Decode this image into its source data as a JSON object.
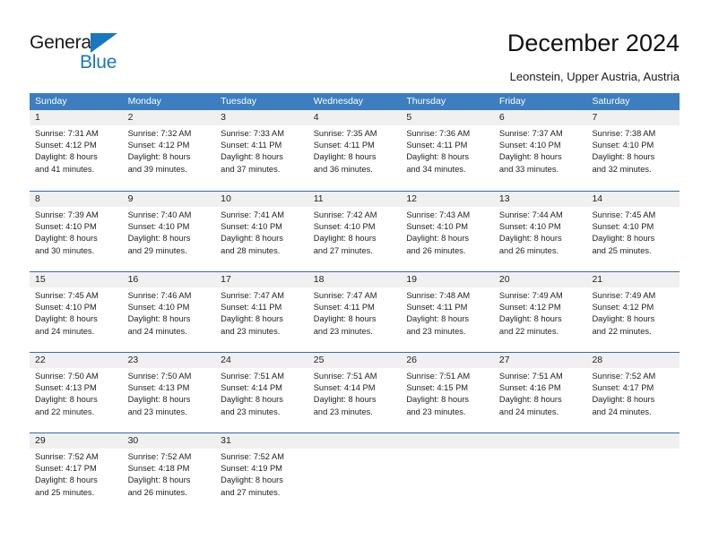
{
  "brand": {
    "name_part1": "General",
    "name_part2": "Blue",
    "triangle_icon": "triangle-icon",
    "accent_color": "#1877BF"
  },
  "header": {
    "title": "December 2024",
    "subtitle": "Leonstein, Upper Austria, Austria"
  },
  "calendar": {
    "header_color": "#3C7EBF",
    "row_separator_color": "#2E6DAE",
    "date_strip_color": "#F0F0F0",
    "day_headers": [
      "Sunday",
      "Monday",
      "Tuesday",
      "Wednesday",
      "Thursday",
      "Friday",
      "Saturday"
    ],
    "weeks": [
      [
        {
          "date": "1",
          "sunrise": "Sunrise: 7:31 AM",
          "sunset": "Sunset: 4:12 PM",
          "daylight_1": "Daylight: 8 hours",
          "daylight_2": "and 41 minutes."
        },
        {
          "date": "2",
          "sunrise": "Sunrise: 7:32 AM",
          "sunset": "Sunset: 4:12 PM",
          "daylight_1": "Daylight: 8 hours",
          "daylight_2": "and 39 minutes."
        },
        {
          "date": "3",
          "sunrise": "Sunrise: 7:33 AM",
          "sunset": "Sunset: 4:11 PM",
          "daylight_1": "Daylight: 8 hours",
          "daylight_2": "and 37 minutes."
        },
        {
          "date": "4",
          "sunrise": "Sunrise: 7:35 AM",
          "sunset": "Sunset: 4:11 PM",
          "daylight_1": "Daylight: 8 hours",
          "daylight_2": "and 36 minutes."
        },
        {
          "date": "5",
          "sunrise": "Sunrise: 7:36 AM",
          "sunset": "Sunset: 4:11 PM",
          "daylight_1": "Daylight: 8 hours",
          "daylight_2": "and 34 minutes."
        },
        {
          "date": "6",
          "sunrise": "Sunrise: 7:37 AM",
          "sunset": "Sunset: 4:10 PM",
          "daylight_1": "Daylight: 8 hours",
          "daylight_2": "and 33 minutes."
        },
        {
          "date": "7",
          "sunrise": "Sunrise: 7:38 AM",
          "sunset": "Sunset: 4:10 PM",
          "daylight_1": "Daylight: 8 hours",
          "daylight_2": "and 32 minutes."
        }
      ],
      [
        {
          "date": "8",
          "sunrise": "Sunrise: 7:39 AM",
          "sunset": "Sunset: 4:10 PM",
          "daylight_1": "Daylight: 8 hours",
          "daylight_2": "and 30 minutes."
        },
        {
          "date": "9",
          "sunrise": "Sunrise: 7:40 AM",
          "sunset": "Sunset: 4:10 PM",
          "daylight_1": "Daylight: 8 hours",
          "daylight_2": "and 29 minutes."
        },
        {
          "date": "10",
          "sunrise": "Sunrise: 7:41 AM",
          "sunset": "Sunset: 4:10 PM",
          "daylight_1": "Daylight: 8 hours",
          "daylight_2": "and 28 minutes."
        },
        {
          "date": "11",
          "sunrise": "Sunrise: 7:42 AM",
          "sunset": "Sunset: 4:10 PM",
          "daylight_1": "Daylight: 8 hours",
          "daylight_2": "and 27 minutes."
        },
        {
          "date": "12",
          "sunrise": "Sunrise: 7:43 AM",
          "sunset": "Sunset: 4:10 PM",
          "daylight_1": "Daylight: 8 hours",
          "daylight_2": "and 26 minutes."
        },
        {
          "date": "13",
          "sunrise": "Sunrise: 7:44 AM",
          "sunset": "Sunset: 4:10 PM",
          "daylight_1": "Daylight: 8 hours",
          "daylight_2": "and 26 minutes."
        },
        {
          "date": "14",
          "sunrise": "Sunrise: 7:45 AM",
          "sunset": "Sunset: 4:10 PM",
          "daylight_1": "Daylight: 8 hours",
          "daylight_2": "and 25 minutes."
        }
      ],
      [
        {
          "date": "15",
          "sunrise": "Sunrise: 7:45 AM",
          "sunset": "Sunset: 4:10 PM",
          "daylight_1": "Daylight: 8 hours",
          "daylight_2": "and 24 minutes."
        },
        {
          "date": "16",
          "sunrise": "Sunrise: 7:46 AM",
          "sunset": "Sunset: 4:10 PM",
          "daylight_1": "Daylight: 8 hours",
          "daylight_2": "and 24 minutes."
        },
        {
          "date": "17",
          "sunrise": "Sunrise: 7:47 AM",
          "sunset": "Sunset: 4:11 PM",
          "daylight_1": "Daylight: 8 hours",
          "daylight_2": "and 23 minutes."
        },
        {
          "date": "18",
          "sunrise": "Sunrise: 7:47 AM",
          "sunset": "Sunset: 4:11 PM",
          "daylight_1": "Daylight: 8 hours",
          "daylight_2": "and 23 minutes."
        },
        {
          "date": "19",
          "sunrise": "Sunrise: 7:48 AM",
          "sunset": "Sunset: 4:11 PM",
          "daylight_1": "Daylight: 8 hours",
          "daylight_2": "and 23 minutes."
        },
        {
          "date": "20",
          "sunrise": "Sunrise: 7:49 AM",
          "sunset": "Sunset: 4:12 PM",
          "daylight_1": "Daylight: 8 hours",
          "daylight_2": "and 22 minutes."
        },
        {
          "date": "21",
          "sunrise": "Sunrise: 7:49 AM",
          "sunset": "Sunset: 4:12 PM",
          "daylight_1": "Daylight: 8 hours",
          "daylight_2": "and 22 minutes."
        }
      ],
      [
        {
          "date": "22",
          "sunrise": "Sunrise: 7:50 AM",
          "sunset": "Sunset: 4:13 PM",
          "daylight_1": "Daylight: 8 hours",
          "daylight_2": "and 22 minutes."
        },
        {
          "date": "23",
          "sunrise": "Sunrise: 7:50 AM",
          "sunset": "Sunset: 4:13 PM",
          "daylight_1": "Daylight: 8 hours",
          "daylight_2": "and 23 minutes."
        },
        {
          "date": "24",
          "sunrise": "Sunrise: 7:51 AM",
          "sunset": "Sunset: 4:14 PM",
          "daylight_1": "Daylight: 8 hours",
          "daylight_2": "and 23 minutes."
        },
        {
          "date": "25",
          "sunrise": "Sunrise: 7:51 AM",
          "sunset": "Sunset: 4:14 PM",
          "daylight_1": "Daylight: 8 hours",
          "daylight_2": "and 23 minutes."
        },
        {
          "date": "26",
          "sunrise": "Sunrise: 7:51 AM",
          "sunset": "Sunset: 4:15 PM",
          "daylight_1": "Daylight: 8 hours",
          "daylight_2": "and 23 minutes."
        },
        {
          "date": "27",
          "sunrise": "Sunrise: 7:51 AM",
          "sunset": "Sunset: 4:16 PM",
          "daylight_1": "Daylight: 8 hours",
          "daylight_2": "and 24 minutes."
        },
        {
          "date": "28",
          "sunrise": "Sunrise: 7:52 AM",
          "sunset": "Sunset: 4:17 PM",
          "daylight_1": "Daylight: 8 hours",
          "daylight_2": "and 24 minutes."
        }
      ],
      [
        {
          "date": "29",
          "sunrise": "Sunrise: 7:52 AM",
          "sunset": "Sunset: 4:17 PM",
          "daylight_1": "Daylight: 8 hours",
          "daylight_2": "and 25 minutes."
        },
        {
          "date": "30",
          "sunrise": "Sunrise: 7:52 AM",
          "sunset": "Sunset: 4:18 PM",
          "daylight_1": "Daylight: 8 hours",
          "daylight_2": "and 26 minutes."
        },
        {
          "date": "31",
          "sunrise": "Sunrise: 7:52 AM",
          "sunset": "Sunset: 4:19 PM",
          "daylight_1": "Daylight: 8 hours",
          "daylight_2": "and 27 minutes."
        },
        {
          "date": "",
          "sunrise": "",
          "sunset": "",
          "daylight_1": "",
          "daylight_2": ""
        },
        {
          "date": "",
          "sunrise": "",
          "sunset": "",
          "daylight_1": "",
          "daylight_2": ""
        },
        {
          "date": "",
          "sunrise": "",
          "sunset": "",
          "daylight_1": "",
          "daylight_2": ""
        },
        {
          "date": "",
          "sunrise": "",
          "sunset": "",
          "daylight_1": "",
          "daylight_2": ""
        }
      ]
    ]
  }
}
